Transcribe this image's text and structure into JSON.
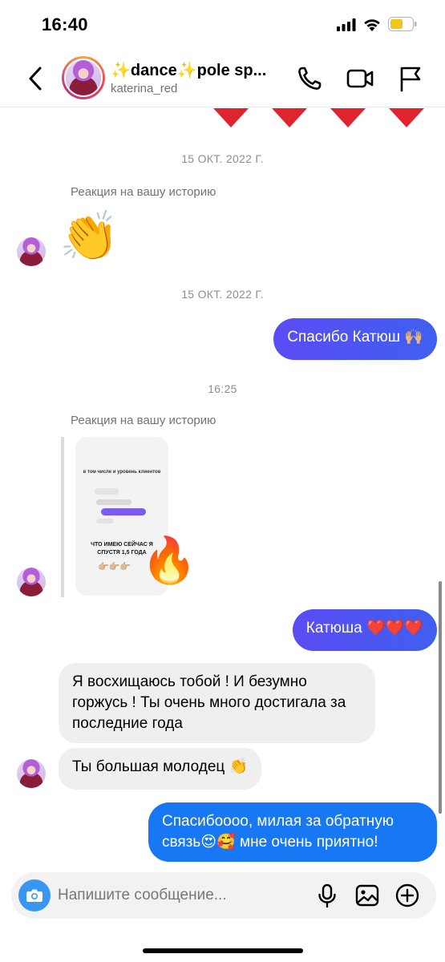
{
  "status_bar": {
    "time": "16:40"
  },
  "header": {
    "title": "✨dance✨pole sp...",
    "username": "katerina_red"
  },
  "chat": {
    "separators": [
      "15 ОКТ. 2022 Г.",
      "15 ОКТ. 2022 Г.",
      "16:25"
    ],
    "reaction_label_1": "Реакция на вашу историю",
    "reaction_emoji_1": "👏",
    "outgoing_1": "Спасибо Катюш 🙌🏼",
    "reaction_label_2": "Реакция на вашу историю",
    "story": {
      "line1": "в том числе и уровень клиентов",
      "line2": "ЧТО ИМЕЮ СЕЙЧАС Я СПУСТЯ 1,5 ГОДА",
      "pointers": "👉🏼👉🏼👉🏼"
    },
    "story_reaction": "🔥",
    "outgoing_2": "Катюша ❤️❤️❤️",
    "incoming_1": "Я восхищаюсь тобой ! И безумно горжусь ! Ты очень много достигала за последние года",
    "incoming_2": "Ты большая молодец 👏",
    "outgoing_3": "Спасибоооо, милая за обратную связь😍🥰 мне очень приятно!"
  },
  "composer": {
    "placeholder": "Напишите сообщение..."
  },
  "colors": {
    "outgoing_bubble": "#3f5ff0",
    "incoming_bubble": "#efefef",
    "camera_button": "#3897f0",
    "heart": "#e0242f"
  }
}
